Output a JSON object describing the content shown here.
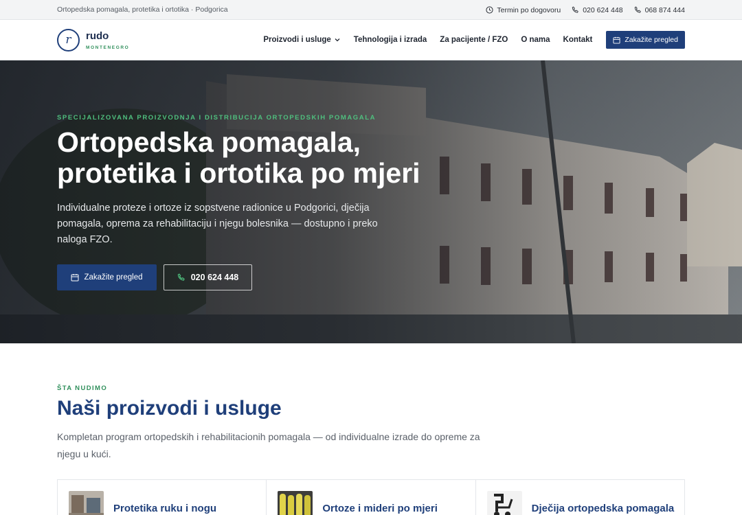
{
  "topbar": {
    "tagline": "Ortopedska pomagala, protetika i ortotika · Podgorica",
    "hours": "Termin po dogovoru",
    "phone1": "020 624 448",
    "phone2": "068 874 444"
  },
  "logo": {
    "name": "rudo",
    "sub": "MONTENEGRO",
    "mark": "r"
  },
  "nav": {
    "items": [
      "Proizvodi i usluge",
      "Tehnologija i izrada",
      "Za pacijente / FZO",
      "O nama",
      "Kontakt"
    ],
    "cta": "Zakažite pregled"
  },
  "hero": {
    "eyebrow": "SPECIJALIZOVANA PROIZVODNJA I DISTRIBUCIJA ORTOPEDSKIH POMAGALA",
    "title": "Ortopedska pomagala, protetika i ortotika po mjeri",
    "description": "Individualne proteze i ortoze iz sopstvene radionice u Podgorici, dječija pomagala, oprema za rehabilitaciju i njegu bolesnika — dostupno i preko naloga FZO.",
    "primary_cta": "Zakažite pregled",
    "secondary_cta": "020 624 448"
  },
  "section": {
    "eyebrow": "ŠTA NUDIMO",
    "title": "Naši proizvodi i usluge",
    "description": "Kompletan program ortopedskih i rehabilitacionih pomagala — od individualne izrade do opreme za njegu u kući."
  },
  "cards": [
    {
      "title": "Protetika ruku i nogu"
    },
    {
      "title": "Ortoze i mideri po mjeri"
    },
    {
      "title": "Dječija ortopedska pomagala"
    }
  ],
  "colors": {
    "brand": "#1f3f7a",
    "accent": "#2f8f5b",
    "accent_light": "#4fbf7e"
  }
}
